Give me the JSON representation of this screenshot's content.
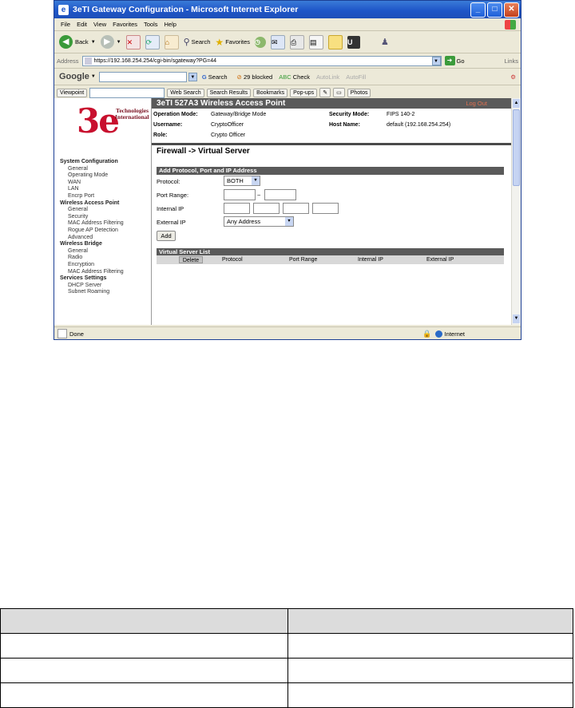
{
  "window": {
    "title": "3eTI Gateway Configuration - Microsoft Internet Explorer",
    "controls": [
      "_",
      "□",
      "✕"
    ]
  },
  "menu": [
    "File",
    "Edit",
    "View",
    "Favorites",
    "Tools",
    "Help"
  ],
  "toolbar": {
    "back": "Back",
    "search": "Search",
    "favorites": "Favorites"
  },
  "address": {
    "label": "Address",
    "url": "https://192.168.254.254/cgi-bin/sgateway?PG=44",
    "go": "Go",
    "links": "Links"
  },
  "google": {
    "logo": "Google",
    "search_btn": "Search",
    "blocked": "29 blocked",
    "check": "Check",
    "autolink": "AutoLink",
    "autofill": "AutoFill"
  },
  "viewbar": {
    "viewpoint": "Viewpoint",
    "web_search": "Web Search",
    "search_results": "Search Results",
    "bookmarks": "Bookmarks",
    "popups": "Pop-ups",
    "photos": "Photos"
  },
  "logo": {
    "mark": "3e",
    "company_line1": "Technologies",
    "company_line2": "International"
  },
  "nav": [
    {
      "type": "h",
      "label": "System Configuration"
    },
    {
      "type": "i",
      "label": "General"
    },
    {
      "type": "i",
      "label": "Operating Mode"
    },
    {
      "type": "i",
      "label": "WAN"
    },
    {
      "type": "i",
      "label": "LAN"
    },
    {
      "type": "i",
      "label": "Encrp Port"
    },
    {
      "type": "h",
      "label": "Wireless Access Point"
    },
    {
      "type": "i",
      "label": "General"
    },
    {
      "type": "i",
      "label": "Security"
    },
    {
      "type": "i",
      "label": "MAC Address Filtering"
    },
    {
      "type": "i",
      "label": "Rogue AP Detection"
    },
    {
      "type": "i",
      "label": "Advanced"
    },
    {
      "type": "h",
      "label": "Wireless Bridge"
    },
    {
      "type": "i",
      "label": "General"
    },
    {
      "type": "i",
      "label": "Radio"
    },
    {
      "type": "i",
      "label": "Encryption"
    },
    {
      "type": "i",
      "label": "MAC Address Filtering"
    },
    {
      "type": "h",
      "label": "Services Settings"
    },
    {
      "type": "i",
      "label": "DHCP Server"
    },
    {
      "type": "i",
      "label": "Subnet Roaming"
    }
  ],
  "device": {
    "name": "3eTI 527A3 Wireless Access Point",
    "logout": "Log Out",
    "op_mode_label": "Operation Mode:",
    "op_mode": "Gateway/Bridge Mode",
    "username_label": "Username:",
    "username": "CryptoOfficer",
    "role_label": "Role:",
    "role": "Crypto Officer",
    "sec_mode_label": "Security Mode:",
    "sec_mode": "FIPS 140-2",
    "host_label": "Host Name:",
    "host": "default (192.168.254.254)"
  },
  "page": {
    "breadcrumb": "Firewall -> Virtual Server",
    "section": "Add Protocol, Port and IP Address",
    "protocol_label": "Protocol:",
    "protocol_value": "BOTH",
    "port_range_label": "Port Range:",
    "port_sep": "~",
    "internal_ip_label": "Internal IP",
    "external_ip_label": "External IP",
    "external_ip_value": "Any Address",
    "add_button": "Add",
    "list_title": "Virtual Server List",
    "list_cols": {
      "delete": "Delete",
      "protocol": "Protocol",
      "port_range": "Port Range",
      "internal_ip": "Internal IP",
      "external_ip": "External IP"
    }
  },
  "status": {
    "text": "Done",
    "zone": "Internet"
  }
}
